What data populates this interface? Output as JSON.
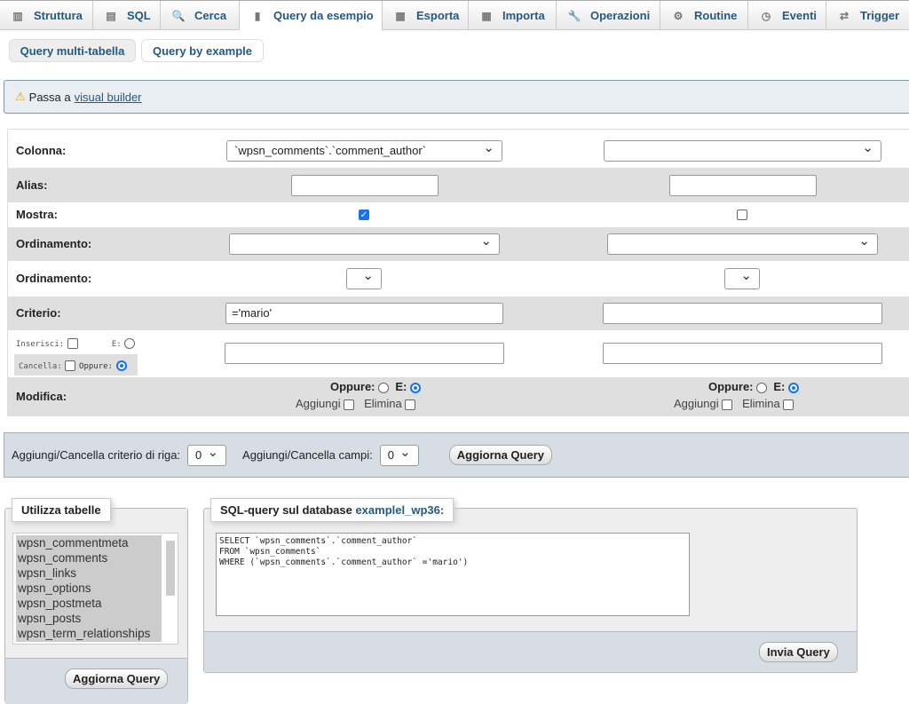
{
  "tabs": [
    {
      "label": "Struttura",
      "icon": "structure-icon"
    },
    {
      "label": "SQL",
      "icon": "sql-icon"
    },
    {
      "label": "Cerca",
      "icon": "search-icon"
    },
    {
      "label": "Query da esempio",
      "icon": "database-icon",
      "active": true
    },
    {
      "label": "Esporta",
      "icon": "export-icon"
    },
    {
      "label": "Importa",
      "icon": "import-icon"
    },
    {
      "label": "Operazioni",
      "icon": "wrench-icon"
    },
    {
      "label": "Routine",
      "icon": "routine-icon"
    },
    {
      "label": "Eventi",
      "icon": "clock-icon"
    },
    {
      "label": "Trigger",
      "icon": "trigger-icon"
    }
  ],
  "subtabs": [
    "Query multi-tabella",
    "Query by example"
  ],
  "notice": {
    "text": "Passa a",
    "link": "visual builder"
  },
  "grid": {
    "labels": {
      "colonna": "Colonna:",
      "alias": "Alias:",
      "mostra": "Mostra:",
      "ordinamento1": "Ordinamento:",
      "ordinamento2": "Ordinamento:",
      "criterio": "Criterio:",
      "modifica": "Modifica:"
    },
    "inserisci": "Inserisci:",
    "cancella": "Cancella:",
    "e": "E:",
    "oppure": "Oppure:",
    "aggiungi": "Aggiungi",
    "elimina": "Elimina",
    "columns": [
      {
        "colonna": "`wpsn_comments`.`comment_author`",
        "alias": "",
        "mostra": true,
        "criterio": "='mario'",
        "modifica_e": true
      },
      {
        "colonna": "",
        "alias": "",
        "mostra": false,
        "criterio": "",
        "modifica_e": true
      }
    ]
  },
  "bar": {
    "rows_label": "Aggiungi/Cancella criterio di riga:",
    "rows_value": "0",
    "fields_label": "Aggiungi/Cancella campi:",
    "fields_value": "0",
    "update": "Aggiorna Query"
  },
  "tables": {
    "legend": "Utilizza tabelle",
    "items": [
      "wpsn_commentmeta",
      "wpsn_comments",
      "wpsn_links",
      "wpsn_options",
      "wpsn_postmeta",
      "wpsn_posts",
      "wpsn_term_relationships"
    ],
    "update": "Aggiorna Query"
  },
  "sql": {
    "legend": "SQL-query sul database",
    "db": "examplel_wp36:",
    "query": "SELECT `wpsn_comments`.`comment_author`\nFROM `wpsn_comments`\nWHERE (`wpsn_comments`.`comment_author` ='mario')",
    "submit": "Invia Query"
  }
}
